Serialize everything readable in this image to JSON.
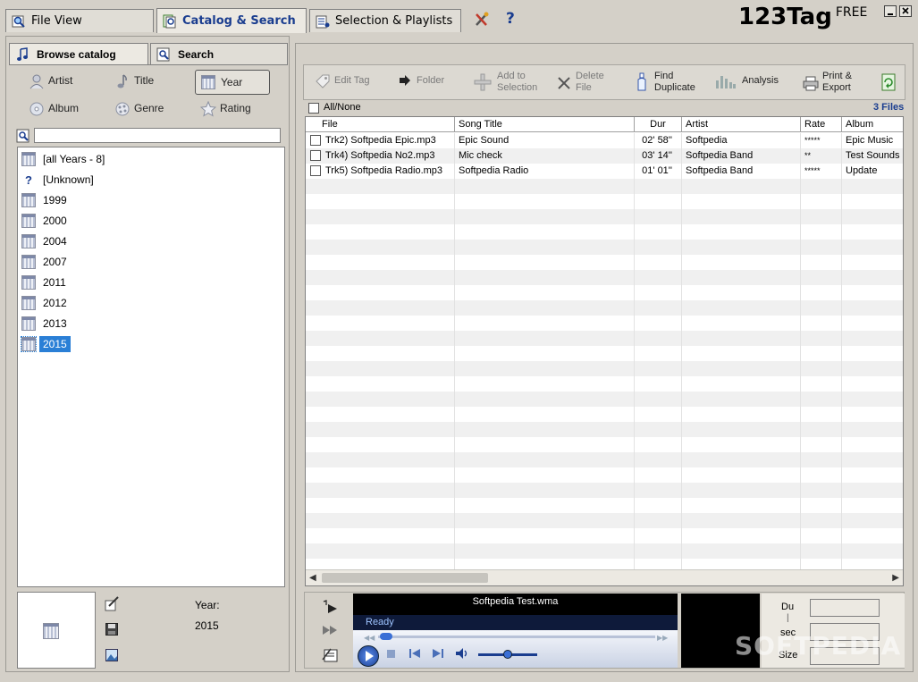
{
  "tabs": [
    {
      "label": "File View",
      "icon": "magnifier-icon"
    },
    {
      "label": "Catalog & Search",
      "icon": "catalog-icon",
      "active": true
    },
    {
      "label": "Selection & Playlists",
      "icon": "playlist-icon"
    }
  ],
  "app": {
    "name": "123Tag",
    "edition": "FREE",
    "help": "?"
  },
  "left": {
    "subtabs": [
      {
        "label": "Browse catalog"
      },
      {
        "label": "Search"
      }
    ],
    "browse_buttons": [
      {
        "label": "Artist"
      },
      {
        "label": "Title"
      },
      {
        "label": "Year"
      },
      {
        "label": "Album"
      },
      {
        "label": "Genre"
      },
      {
        "label": "Rating"
      }
    ],
    "filter_value": "",
    "years": [
      "[all Years - 8]",
      "[Unknown]",
      "1999",
      "2000",
      "2004",
      "2007",
      "2011",
      "2012",
      "2013",
      "2015"
    ],
    "selected_year": "2015",
    "detail": {
      "label": "Year:",
      "value": "2015"
    }
  },
  "toolbar": {
    "edit_tag": "Edit Tag",
    "folder": "Folder",
    "add_line1": "Add to",
    "add_line2": "Selection",
    "delete_line1": "Delete",
    "delete_line2": "File",
    "find_line1": "Find",
    "find_line2": "Duplicate",
    "analysis": "Analysis",
    "print_line1": "Print &",
    "print_line2": "Export"
  },
  "list": {
    "all_none": "All/None",
    "count": "3 Files",
    "columns": [
      "File",
      "Song Title",
      "Dur",
      "Artist",
      "Rate",
      "Album"
    ],
    "rows": [
      {
        "file": "Trk2) Softpedia Epic.mp3",
        "title": "Epic Sound",
        "dur": "02' 58''",
        "artist": "Softpedia",
        "rate": "*****",
        "album": "Epic Music"
      },
      {
        "file": "Trk4) Softpedia No2.mp3",
        "title": "Mic check",
        "dur": "03' 14''",
        "artist": "Softpedia Band",
        "rate": "**",
        "album": "Test Sounds"
      },
      {
        "file": "Trk5) Softpedia Radio.mp3",
        "title": "Softpedia Radio",
        "dur": "01' 01''",
        "artist": "Softpedia Band",
        "rate": "*****",
        "album": "Update"
      }
    ]
  },
  "player": {
    "track": "Softpedia Test.wma",
    "status": "Ready",
    "du_label": "Du",
    "sep": "|",
    "sec_label": "sec",
    "size_label": "Size"
  },
  "watermark": "SOFTPEDIA",
  "colors": {
    "accent": "#1a3d8f",
    "selection": "#2a7fd6",
    "player_bg": "#000000"
  }
}
